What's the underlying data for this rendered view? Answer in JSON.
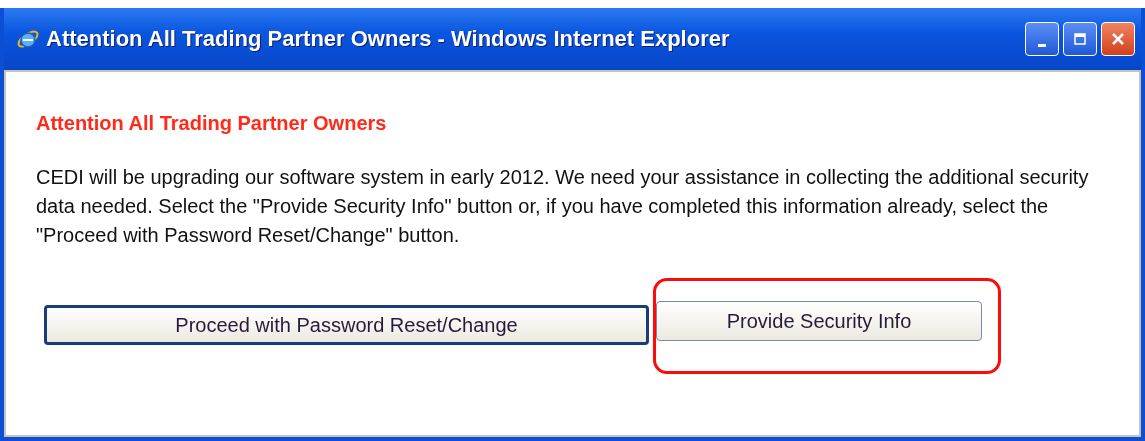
{
  "window": {
    "title": "Attention All Trading Partner Owners - Windows Internet Explorer"
  },
  "heading": "Attention All Trading Partner Owners",
  "message": "CEDI will be upgrading our software system in early 2012. We need your assistance in collecting the additional security data needed. Select the \"Provide Security Info\" button or, if you have completed this information already, select the \"Proceed with Password Reset/Change\" button.",
  "buttons": [
    {
      "label": "Proceed with Password Reset/Change",
      "focused": true,
      "circled": false
    },
    {
      "label": "Provide Security Info",
      "focused": false,
      "circled": true
    }
  ]
}
